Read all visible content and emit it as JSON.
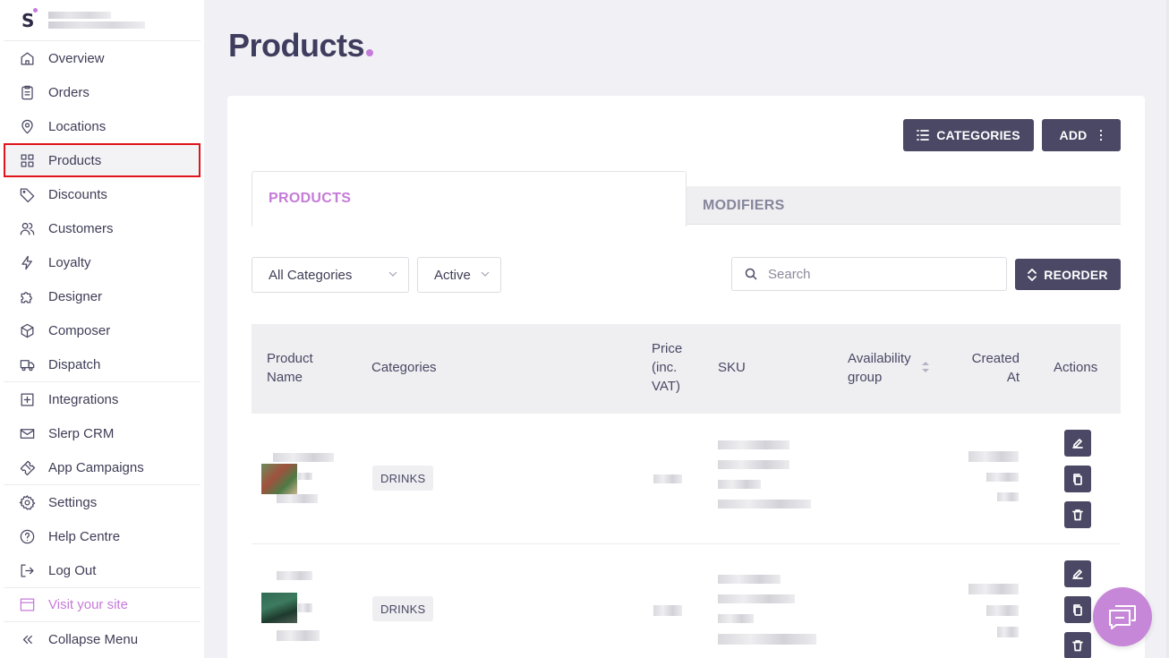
{
  "sidebar": {
    "logo_letter": "S",
    "groups": [
      [
        {
          "label": "Overview",
          "icon": "home-icon"
        },
        {
          "label": "Orders",
          "icon": "clipboard-icon"
        },
        {
          "label": "Locations",
          "icon": "map-pin-icon"
        },
        {
          "label": "Products",
          "icon": "grid-icon",
          "active": true
        },
        {
          "label": "Discounts",
          "icon": "tag-icon"
        },
        {
          "label": "Customers",
          "icon": "users-icon"
        },
        {
          "label": "Loyalty",
          "icon": "lightning-icon"
        },
        {
          "label": "Designer",
          "icon": "puzzle-icon"
        },
        {
          "label": "Composer",
          "icon": "box-icon"
        },
        {
          "label": "Dispatch",
          "icon": "truck-icon"
        }
      ],
      [
        {
          "label": "Integrations",
          "icon": "plus-square-icon"
        },
        {
          "label": "Slerp CRM",
          "icon": "mail-icon"
        },
        {
          "label": "App Campaigns",
          "icon": "ticket-icon"
        }
      ],
      [
        {
          "label": "Settings",
          "icon": "gear-icon"
        },
        {
          "label": "Help Centre",
          "icon": "help-circle-icon"
        },
        {
          "label": "Log Out",
          "icon": "log-out-icon"
        }
      ]
    ],
    "visit_site": "Visit your site",
    "collapse": "Collapse Menu"
  },
  "page": {
    "title": "Products"
  },
  "toolbar": {
    "categories_label": "CATEGORIES",
    "add_label": "ADD"
  },
  "tabs": {
    "products": "PRODUCTS",
    "modifiers": "MODIFIERS"
  },
  "filters": {
    "category_value": "All Categories",
    "status_value": "Active",
    "search_placeholder": "Search",
    "reorder_label": "REORDER"
  },
  "table": {
    "headers": {
      "product_name": "Product Name",
      "categories": "Categories",
      "price": "Price (inc. VAT)",
      "sku": "SKU",
      "availability": "Availability group",
      "created": "Created At",
      "actions": "Actions"
    },
    "rows": [
      {
        "category": "DRINKS"
      },
      {
        "category": "DRINKS"
      }
    ]
  },
  "colors": {
    "accent": "#c57bd8",
    "primary_dark": "#4a4864",
    "highlight_outline": "#e0141a"
  }
}
